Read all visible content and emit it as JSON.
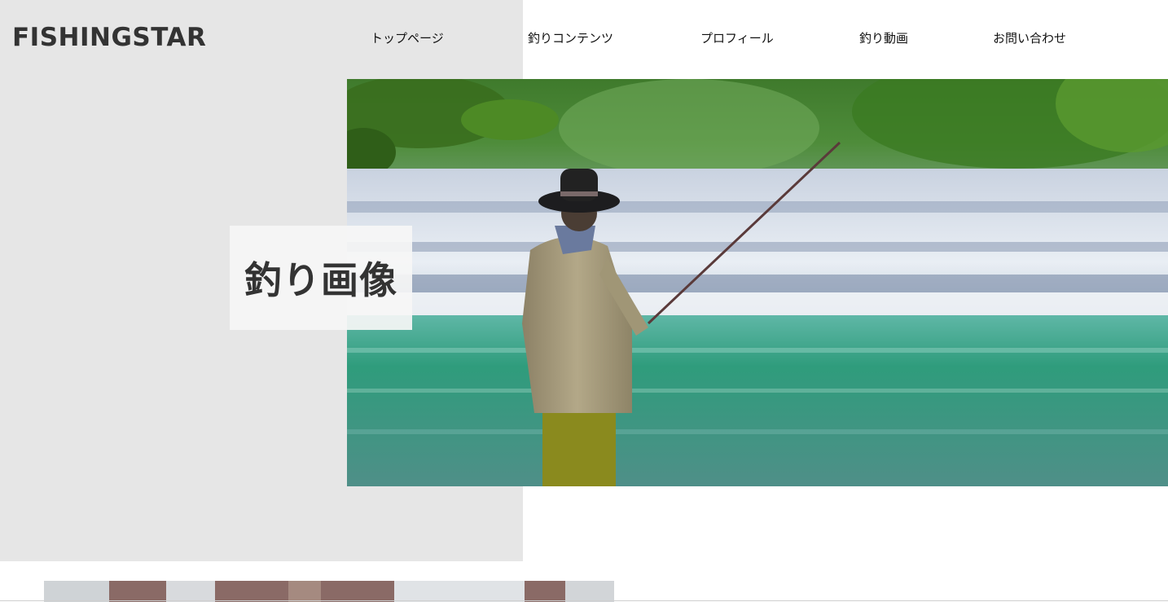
{
  "site": {
    "logo": "FISHINGSTAR"
  },
  "nav": {
    "items": [
      {
        "label": "トップページ"
      },
      {
        "label": "釣りコンテンツ"
      },
      {
        "label": "プロフィール"
      },
      {
        "label": "釣り動画"
      },
      {
        "label": "お問い合わせ"
      }
    ]
  },
  "hero": {
    "label": "釣り画像"
  },
  "colors": {
    "panel": "#e6e6e6",
    "logo": "#333333",
    "label_bg": "#f6f6f6"
  }
}
